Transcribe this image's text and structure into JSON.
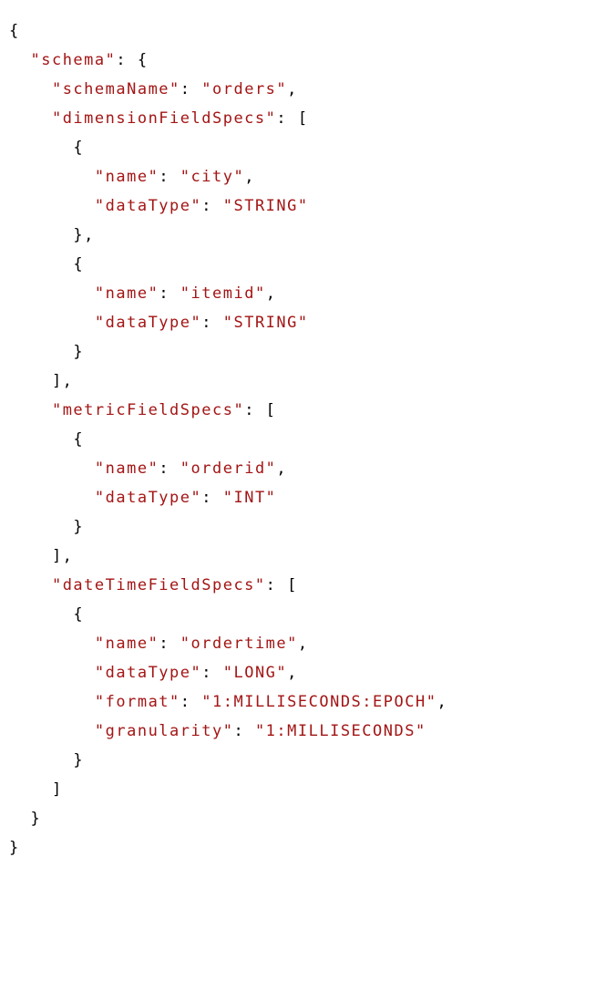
{
  "lines": [
    [
      {
        "t": "{",
        "c": "p"
      }
    ],
    [
      {
        "t": "  ",
        "c": "p"
      },
      {
        "t": "\"schema\"",
        "c": "s"
      },
      {
        "t": ": {",
        "c": "p"
      }
    ],
    [
      {
        "t": "    ",
        "c": "p"
      },
      {
        "t": "\"schemaName\"",
        "c": "s"
      },
      {
        "t": ": ",
        "c": "p"
      },
      {
        "t": "\"orders\"",
        "c": "s"
      },
      {
        "t": ",",
        "c": "p"
      }
    ],
    [
      {
        "t": "    ",
        "c": "p"
      },
      {
        "t": "\"dimensionFieldSpecs\"",
        "c": "s"
      },
      {
        "t": ": [",
        "c": "p"
      }
    ],
    [
      {
        "t": "      {",
        "c": "p"
      }
    ],
    [
      {
        "t": "        ",
        "c": "p"
      },
      {
        "t": "\"name\"",
        "c": "s"
      },
      {
        "t": ": ",
        "c": "p"
      },
      {
        "t": "\"city\"",
        "c": "s"
      },
      {
        "t": ",",
        "c": "p"
      }
    ],
    [
      {
        "t": "        ",
        "c": "p"
      },
      {
        "t": "\"dataType\"",
        "c": "s"
      },
      {
        "t": ": ",
        "c": "p"
      },
      {
        "t": "\"STRING\"",
        "c": "s"
      }
    ],
    [
      {
        "t": "      },",
        "c": "p"
      }
    ],
    [
      {
        "t": "      {",
        "c": "p"
      }
    ],
    [
      {
        "t": "        ",
        "c": "p"
      },
      {
        "t": "\"name\"",
        "c": "s"
      },
      {
        "t": ": ",
        "c": "p"
      },
      {
        "t": "\"itemid\"",
        "c": "s"
      },
      {
        "t": ",",
        "c": "p"
      }
    ],
    [
      {
        "t": "        ",
        "c": "p"
      },
      {
        "t": "\"dataType\"",
        "c": "s"
      },
      {
        "t": ": ",
        "c": "p"
      },
      {
        "t": "\"STRING\"",
        "c": "s"
      }
    ],
    [
      {
        "t": "      }",
        "c": "p"
      }
    ],
    [
      {
        "t": "    ],",
        "c": "p"
      }
    ],
    [
      {
        "t": "    ",
        "c": "p"
      },
      {
        "t": "\"metricFieldSpecs\"",
        "c": "s"
      },
      {
        "t": ": [",
        "c": "p"
      }
    ],
    [
      {
        "t": "      {",
        "c": "p"
      }
    ],
    [
      {
        "t": "        ",
        "c": "p"
      },
      {
        "t": "\"name\"",
        "c": "s"
      },
      {
        "t": ": ",
        "c": "p"
      },
      {
        "t": "\"orderid\"",
        "c": "s"
      },
      {
        "t": ",",
        "c": "p"
      }
    ],
    [
      {
        "t": "        ",
        "c": "p"
      },
      {
        "t": "\"dataType\"",
        "c": "s"
      },
      {
        "t": ": ",
        "c": "p"
      },
      {
        "t": "\"INT\"",
        "c": "s"
      }
    ],
    [
      {
        "t": "      }",
        "c": "p"
      }
    ],
    [
      {
        "t": "    ],",
        "c": "p"
      }
    ],
    [
      {
        "t": "    ",
        "c": "p"
      },
      {
        "t": "\"dateTimeFieldSpecs\"",
        "c": "s"
      },
      {
        "t": ": [",
        "c": "p"
      }
    ],
    [
      {
        "t": "      {",
        "c": "p"
      }
    ],
    [
      {
        "t": "        ",
        "c": "p"
      },
      {
        "t": "\"name\"",
        "c": "s"
      },
      {
        "t": ": ",
        "c": "p"
      },
      {
        "t": "\"ordertime\"",
        "c": "s"
      },
      {
        "t": ",",
        "c": "p"
      }
    ],
    [
      {
        "t": "        ",
        "c": "p"
      },
      {
        "t": "\"dataType\"",
        "c": "s"
      },
      {
        "t": ": ",
        "c": "p"
      },
      {
        "t": "\"LONG\"",
        "c": "s"
      },
      {
        "t": ",",
        "c": "p"
      }
    ],
    [
      {
        "t": "        ",
        "c": "p"
      },
      {
        "t": "\"format\"",
        "c": "s"
      },
      {
        "t": ": ",
        "c": "p"
      },
      {
        "t": "\"1:MILLISECONDS:EPOCH\"",
        "c": "s"
      },
      {
        "t": ",",
        "c": "p"
      }
    ],
    [
      {
        "t": "        ",
        "c": "p"
      },
      {
        "t": "\"granularity\"",
        "c": "s"
      },
      {
        "t": ": ",
        "c": "p"
      },
      {
        "t": "\"1:MILLISECONDS\"",
        "c": "s"
      }
    ],
    [
      {
        "t": "      }",
        "c": "p"
      }
    ],
    [
      {
        "t": "    ]",
        "c": "p"
      }
    ],
    [
      {
        "t": "  }",
        "c": "p"
      }
    ],
    [
      {
        "t": "}",
        "c": "p"
      }
    ]
  ]
}
